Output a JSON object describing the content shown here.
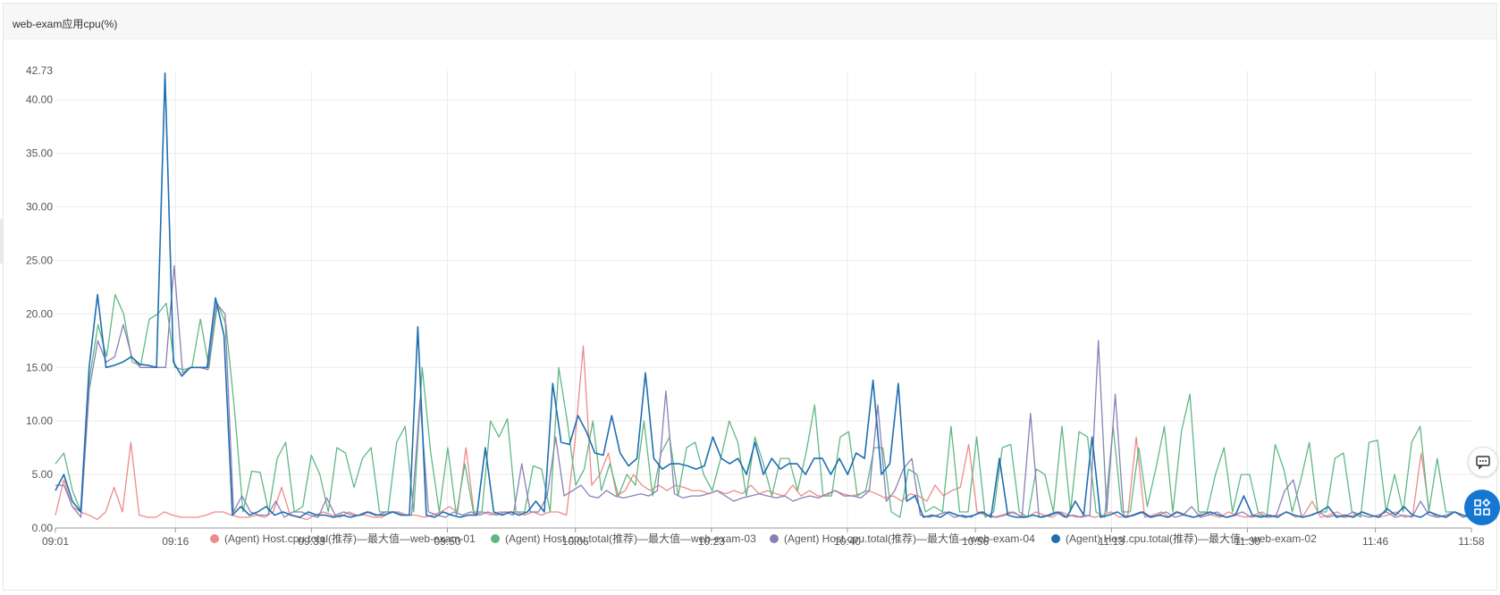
{
  "panel": {
    "title": "web-exam应用cpu(%)"
  },
  "chart_data": {
    "type": "line",
    "title": "web-exam应用cpu(%)",
    "xlabel": "",
    "ylabel": "",
    "ylim": [
      0,
      42.73
    ],
    "yticks": [
      "0.00",
      "5.00",
      "10.00",
      "15.00",
      "20.00",
      "25.00",
      "30.00",
      "35.00",
      "40.00",
      "42.73"
    ],
    "ytick_values": [
      0,
      5,
      10,
      15,
      20,
      25,
      30,
      35,
      40,
      42.73
    ],
    "xticks": [
      "09:01",
      "09:16",
      "09:33",
      "09:50",
      "10:06",
      "10:23",
      "10:40",
      "10:56",
      "11:13",
      "11:30",
      "11:46",
      "11:58"
    ],
    "xtick_minutes": [
      0,
      15,
      32,
      49,
      65,
      82,
      99,
      115,
      132,
      149,
      165,
      177
    ],
    "x_start": "09:01",
    "x_end": "11:58",
    "grid": true,
    "legend_position": "bottom",
    "series": [
      {
        "name": "(Agent) Host.cpu.total(推荐)—最大值—web-exam-01",
        "color": "#ef8a8a",
        "values": [
          1.2,
          4.5,
          2.0,
          1.5,
          1.2,
          0.8,
          1.5,
          3.8,
          1.5,
          8.0,
          1.2,
          1.0,
          1.0,
          1.5,
          1.2,
          1.0,
          1.0,
          1.0,
          1.2,
          1.5,
          1.5,
          1.2,
          1.0,
          1.0,
          1.2,
          1.0,
          1.5,
          3.8,
          1.2,
          1.0,
          0.8,
          1.2,
          1.5,
          1.2,
          1.0,
          1.5,
          1.2,
          1.2,
          1.0,
          1.0,
          1.5,
          1.5,
          1.2,
          1.2,
          1.0,
          1.2,
          1.5,
          2.0,
          1.5,
          7.5,
          1.2,
          1.5,
          1.2,
          1.5,
          1.5,
          1.5,
          1.2,
          1.5,
          1.2,
          1.5,
          1.5,
          1.2,
          8.0,
          17.0,
          4.0,
          5.0,
          7.0,
          3.0,
          3.5,
          5.0,
          4.0,
          3.5,
          4.0,
          3.5,
          4.0,
          3.8,
          3.5,
          3.5,
          3.2,
          3.5,
          3.2,
          3.5,
          3.2,
          4.0,
          3.2,
          3.5,
          3.2,
          3.0,
          4.0,
          3.0,
          3.5,
          3.0,
          3.0,
          3.5,
          3.2,
          3.0,
          3.2,
          3.5,
          3.2,
          2.8,
          3.0,
          2.5,
          3.2,
          3.0,
          2.5,
          4.0,
          3.0,
          3.5,
          3.8,
          7.8,
          1.5,
          1.2,
          1.0,
          1.2,
          1.5,
          1.2,
          1.0,
          1.5,
          1.2,
          1.0,
          1.5,
          1.2,
          1.0,
          1.2,
          1.0,
          1.2,
          1.5,
          1.0,
          1.2,
          8.5,
          1.0,
          1.2,
          1.5,
          1.0,
          1.5,
          1.2,
          1.0,
          1.5,
          1.2,
          1.0,
          1.5,
          1.2,
          1.0,
          1.2,
          1.5,
          1.0,
          1.2,
          1.5,
          1.0,
          1.2,
          2.5,
          1.0,
          1.2,
          1.5,
          1.0,
          1.2,
          1.5,
          1.2,
          1.0,
          1.2,
          1.5,
          1.0,
          1.2,
          7.0,
          1.5,
          1.0,
          1.2,
          1.5,
          1.0,
          1.2
        ]
      },
      {
        "name": "(Agent) Host.cpu.total(推荐)—最大值—web-exam-03",
        "color": "#5fb884",
        "values": [
          6.0,
          7.0,
          3.5,
          1.5,
          14.0,
          19.0,
          16.0,
          21.8,
          20.0,
          15.5,
          15.2,
          19.5,
          20.0,
          21.0,
          15.0,
          14.8,
          15.0,
          19.5,
          15.0,
          21.0,
          19.0,
          11.0,
          1.5,
          5.3,
          5.2,
          1.5,
          6.5,
          8.0,
          1.5,
          2.0,
          6.8,
          5.0,
          1.5,
          7.5,
          7.0,
          3.8,
          6.5,
          7.5,
          1.5,
          1.5,
          8.0,
          9.5,
          1.5,
          15.0,
          7.0,
          1.5,
          7.5,
          1.2,
          6.0,
          1.5,
          1.5,
          10.0,
          8.5,
          10.2,
          1.5,
          1.5,
          5.8,
          5.5,
          1.5,
          15.0,
          10.0,
          4.0,
          5.5,
          10.0,
          3.5,
          6.0,
          3.0,
          5.0,
          4.0,
          10.0,
          3.0,
          7.0,
          8.5,
          3.0,
          7.5,
          8.0,
          5.0,
          3.5,
          6.5,
          10.0,
          8.0,
          3.0,
          8.5,
          6.0,
          3.0,
          6.5,
          6.5,
          3.5,
          7.0,
          11.5,
          3.0,
          3.0,
          8.5,
          9.0,
          3.0,
          3.5,
          7.5,
          7.5,
          1.5,
          1.0,
          5.5,
          5.0,
          1.5,
          2.0,
          1.5,
          9.5,
          1.5,
          1.5,
          8.5,
          1.0,
          1.5,
          7.5,
          7.8,
          1.5,
          1.0,
          5.5,
          5.0,
          1.5,
          9.5,
          1.5,
          9.0,
          8.5,
          1.5,
          1.0,
          9.5,
          1.5,
          1.5,
          7.5,
          2.0,
          5.5,
          9.5,
          1.5,
          9.0,
          12.5,
          1.5,
          1.5,
          5.0,
          7.5,
          1.5,
          5.0,
          5.0,
          1.5,
          1.0,
          7.8,
          5.5,
          1.5,
          4.5,
          8.0,
          1.5,
          1.5,
          6.5,
          7.0,
          1.5,
          1.0,
          8.0,
          8.2,
          1.5,
          5.0,
          1.5,
          8.0,
          9.5,
          1.5,
          6.5,
          1.5,
          1.5,
          1.2,
          1.0
        ]
      },
      {
        "name": "(Agent) Host.cpu.total(推荐)—最大值—web-exam-04",
        "color": "#8c7fb6",
        "values": [
          4.0,
          4.0,
          2.0,
          1.0,
          13.0,
          17.5,
          15.5,
          16.0,
          19.0,
          16.0,
          15.0,
          15.0,
          15.0,
          15.0,
          24.5,
          14.5,
          15.0,
          15.0,
          14.8,
          21.0,
          20.0,
          1.5,
          3.0,
          1.5,
          1.2,
          1.2,
          2.5,
          1.0,
          1.5,
          1.5,
          1.2,
          1.0,
          2.8,
          1.2,
          1.5,
          1.2,
          1.2,
          1.5,
          1.2,
          1.5,
          1.5,
          1.2,
          1.2,
          12.0,
          1.5,
          1.2,
          1.0,
          1.5,
          1.2,
          1.5,
          1.2,
          1.5,
          1.2,
          1.5,
          1.2,
          6.0,
          1.5,
          1.5,
          3.0,
          8.5,
          3.0,
          3.5,
          4.0,
          3.0,
          2.8,
          3.5,
          3.0,
          2.8,
          3.0,
          3.2,
          3.0,
          3.5,
          12.8,
          3.2,
          2.8,
          3.0,
          3.0,
          3.2,
          3.5,
          3.0,
          2.5,
          2.8,
          3.0,
          3.2,
          3.0,
          2.8,
          3.0,
          2.5,
          2.8,
          3.0,
          2.8,
          3.2,
          3.5,
          3.0,
          3.0,
          2.8,
          3.5,
          11.5,
          2.5,
          3.5,
          5.5,
          6.5,
          1.2,
          1.0,
          1.2,
          1.5,
          1.0,
          1.2,
          1.0,
          1.5,
          1.2,
          1.0,
          1.2,
          1.5,
          1.0,
          10.7,
          1.0,
          1.2,
          1.5,
          1.0,
          1.2,
          1.0,
          1.2,
          17.5,
          1.5,
          12.5,
          1.0,
          1.2,
          1.5,
          1.0,
          1.2,
          1.5,
          1.0,
          1.2,
          2.0,
          1.0,
          1.2,
          1.5,
          1.0,
          1.2,
          1.5,
          1.0,
          1.2,
          1.0,
          1.2,
          3.5,
          4.5,
          1.0,
          1.2,
          1.5,
          1.0,
          1.2,
          1.0,
          1.5,
          1.2,
          1.0,
          1.2,
          1.5,
          1.0,
          1.2,
          1.0,
          2.5,
          1.2,
          1.0,
          1.2,
          1.5,
          1.0,
          1.2
        ]
      },
      {
        "name": "(Agent) Host.cpu.total(推荐)—最大值—web-exam-02",
        "color": "#1f6fb0",
        "values": [
          3.5,
          5.0,
          2.5,
          1.5,
          15.0,
          21.8,
          15.0,
          15.2,
          15.5,
          16.0,
          15.3,
          15.2,
          15.0,
          42.5,
          15.5,
          14.2,
          15.0,
          15.0,
          15.0,
          21.5,
          18.0,
          1.2,
          2.0,
          1.2,
          1.5,
          2.0,
          1.2,
          1.5,
          1.2,
          1.0,
          1.5,
          1.2,
          1.2,
          1.0,
          1.2,
          1.0,
          1.2,
          1.5,
          1.2,
          1.2,
          1.5,
          1.2,
          1.2,
          18.8,
          1.2,
          1.0,
          1.5,
          1.2,
          1.0,
          1.2,
          1.2,
          7.5,
          1.5,
          1.2,
          1.5,
          1.2,
          1.5,
          2.5,
          1.5,
          13.5,
          8.0,
          7.8,
          10.5,
          9.0,
          7.0,
          6.8,
          10.5,
          7.0,
          5.8,
          6.5,
          14.5,
          6.5,
          5.5,
          6.0,
          6.0,
          5.8,
          5.5,
          5.8,
          8.5,
          6.5,
          6.0,
          6.5,
          5.0,
          8.0,
          5.0,
          6.5,
          5.5,
          6.0,
          6.0,
          5.0,
          6.5,
          6.5,
          5.0,
          6.5,
          5.0,
          7.0,
          6.5,
          13.8,
          5.0,
          6.0,
          13.5,
          2.5,
          3.0,
          1.0,
          1.2,
          1.0,
          1.5,
          1.2,
          1.0,
          1.2,
          1.5,
          1.0,
          6.5,
          1.2,
          1.0,
          1.0,
          1.2,
          1.0,
          1.2,
          1.5,
          1.0,
          2.5,
          1.2,
          8.5,
          1.0,
          1.2,
          1.5,
          1.0,
          1.2,
          1.5,
          1.0,
          1.2,
          1.0,
          1.5,
          1.2,
          1.0,
          1.2,
          1.5,
          1.2,
          1.0,
          1.2,
          3.0,
          1.2,
          1.0,
          1.2,
          1.0,
          1.5,
          1.2,
          1.0,
          1.2,
          1.5,
          2.0,
          1.0,
          1.2,
          1.0,
          1.5,
          1.2,
          1.0,
          1.8,
          1.2,
          2.0,
          1.2,
          1.0,
          1.5,
          1.2,
          1.0,
          1.5,
          1.2,
          1.0
        ]
      }
    ]
  },
  "sidebar_buttons": {
    "chat_icon": "chat-icon",
    "apps_icon": "apps-icon"
  }
}
